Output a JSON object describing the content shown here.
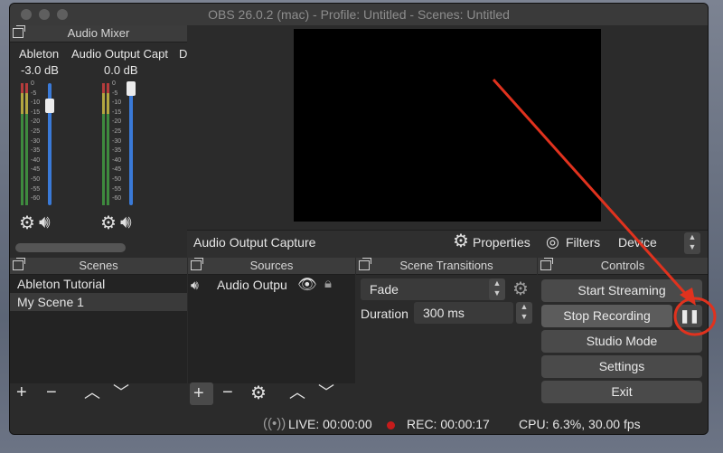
{
  "window": {
    "title": "OBS 26.0.2 (mac) - Profile: Untitled - Scenes: Untitled"
  },
  "mixer": {
    "header": "Audio Mixer",
    "channels": [
      {
        "name": "Ableton",
        "db": "-3.0 dB",
        "level": 0.78
      },
      {
        "name": "Audio Output Capt",
        "db": "0.0 dB",
        "level": 1.0
      },
      {
        "name": "D",
        "db": "",
        "level": 0
      }
    ],
    "ticks": "0\n-5\n-10\n-15\n-20\n-25\n-30\n-35\n-40\n-45\n-50\n-55\n-60"
  },
  "source_toolbar": {
    "current_source": "Audio Output Capture",
    "properties": "Properties",
    "filters": "Filters",
    "device": "Device"
  },
  "scenes": {
    "header": "Scenes",
    "items": [
      "Ableton Tutorial",
      "My Scene 1"
    ],
    "selected": "My Scene 1"
  },
  "sources": {
    "header": "Sources",
    "items": [
      "Audio Outpu"
    ]
  },
  "transitions": {
    "header": "Scene Transitions",
    "type": "Fade",
    "duration_label": "Duration",
    "duration_value": "300 ms"
  },
  "controls": {
    "header": "Controls",
    "buttons": [
      "Start Streaming",
      "Stop Recording",
      "Studio Mode",
      "Settings",
      "Exit"
    ]
  },
  "status": {
    "live": "LIVE: 00:00:00",
    "rec": "REC: 00:00:17",
    "cpu": "CPU: 6.3%, 30.00 fps"
  },
  "colors": {
    "annotation": "#e0321e",
    "accent": "#3a7ad8",
    "rec_dot": "#c51b1b"
  }
}
